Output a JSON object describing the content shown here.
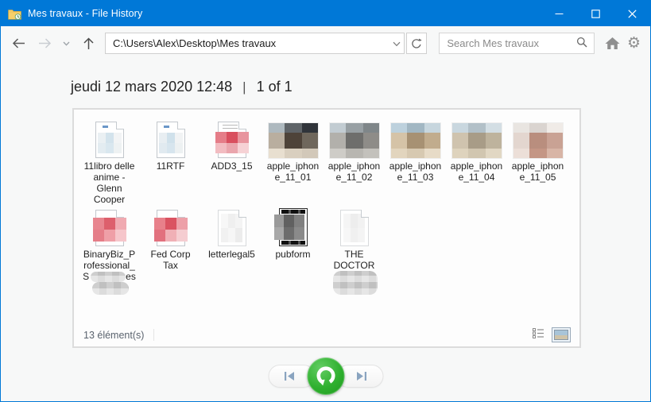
{
  "window": {
    "title": "Mes travaux - File History"
  },
  "toolbar": {
    "address": "C:\\Users\\Alex\\Desktop\\Mes travaux",
    "search_placeholder": "Search Mes travaux"
  },
  "icons": {
    "gear": "⚙"
  },
  "header": {
    "date": "jeudi 12 mars 2020 12:48",
    "separator": "|",
    "pager": "1 of 1"
  },
  "status": {
    "items_count": "13 élément(s)"
  },
  "colors": {
    "titlebar_bg": "#0078d7",
    "window_border": "#0078d7",
    "content_bg": "#f7f8f8",
    "panel_border": "#dcdcdc",
    "restore_green": "#2fb02f",
    "nav_icon_blue": "#8aa4c0",
    "icon_gray": "#8f8f8f"
  },
  "files": [
    {
      "label": "11libro delle anime - Glenn Cooper",
      "kind": "doc",
      "tint": "blue",
      "blocks": [
        "#eaf0f3",
        "#d3e3ec",
        "#f2f4f5",
        "#e3ecf1",
        "#d9e7ef",
        "#eef2f3"
      ]
    },
    {
      "label": "11RTF",
      "kind": "doc",
      "tint": "blue",
      "blocks": [
        "#e8eef2",
        "#d0e1eb",
        "#f1f3f4",
        "#e1eaf0",
        "#d7e5ee",
        "#edf1f2"
      ]
    },
    {
      "label": "ADD3_15",
      "kind": "doc",
      "tint": "red",
      "lines": true,
      "blocks": [
        "#e57d88",
        "#d94f5e",
        "#e8959e",
        "#f2bcc1",
        "#eaa6ad",
        "#f6d2d5"
      ]
    },
    {
      "label": "apple_iphone_11_01",
      "kind": "photo",
      "blocks": [
        "#aeb9bf",
        "#5f6468",
        "#30343a",
        "#b9ae9f",
        "#4e4339",
        "#6f675c",
        "#e8dfd0",
        "#d9cfbf",
        "#d2c8b9"
      ]
    },
    {
      "label": "apple_iphone_11_02",
      "kind": "photo",
      "blocks": [
        "#c2ccd2",
        "#98a0a4",
        "#7f8689",
        "#b2b0ab",
        "#6e6e6c",
        "#8e8c88",
        "#ceccc7",
        "#b8b6b1",
        "#c3c1bc"
      ]
    },
    {
      "label": "apple_iphone_11_03",
      "kind": "photo",
      "blocks": [
        "#bdd1dd",
        "#a2b7c3",
        "#c7d6de",
        "#d5c3a7",
        "#a79173",
        "#c1ac8d",
        "#e2d5be",
        "#d7c9b1",
        "#e7dbc7"
      ]
    },
    {
      "label": "apple_iphone_11_04",
      "kind": "photo",
      "blocks": [
        "#c9d7df",
        "#b2c0c8",
        "#d3dee4",
        "#cfc3ae",
        "#a89c87",
        "#beb39d",
        "#ded3bd",
        "#d1c6b0",
        "#e1d7c3"
      ]
    },
    {
      "label": "apple_iphone_11_05",
      "kind": "photo",
      "blocks": [
        "#e9e5e1",
        "#dad4d0",
        "#f0ebe7",
        "#e3d6cf",
        "#b98e7e",
        "#c9a294",
        "#ecdfd8",
        "#c49685",
        "#d8b5a6"
      ]
    },
    {
      "label_parts": [
        {
          "text": "BinaryBiz_Professional_S"
        },
        {
          "redact": [
            44,
            13
          ]
        },
        {
          "text": "es"
        },
        {
          "redact": [
            46,
            16
          ]
        }
      ],
      "kind": "doc",
      "tint": "red",
      "blocks": [
        "#e8858f",
        "#dd5f6c",
        "#f0aab1",
        "#e57d88",
        "#ef9fa7",
        "#f6c6cb"
      ]
    },
    {
      "label": "Fed Corp Tax",
      "kind": "doc",
      "tint": "red",
      "blocks": [
        "#e8808a",
        "#da5361",
        "#eda0a8",
        "#e2717e",
        "#f0b0b6",
        "#f5cdd1"
      ]
    },
    {
      "label": "letterlegal5",
      "kind": "doc",
      "tint": "white",
      "blocks": [
        "#f7f7f7",
        "#efefef",
        "#f4f4f4",
        "#f1f1f1",
        "#f6f6f6",
        "#ececec"
      ]
    },
    {
      "label": "pubform",
      "kind": "pub",
      "blocks": [
        "#9a9a9a",
        "#606060",
        "#808080",
        "#a8a8a8",
        "#6c6c6c",
        "#8a8a8a"
      ]
    },
    {
      "label_parts": [
        {
          "text": "THE DOCTOR"
        },
        {
          "redact": [
            56,
            30
          ]
        }
      ],
      "kind": "doc",
      "tint": "white",
      "blocks": [
        "#f5f5f5",
        "#ededed",
        "#f2f2f2",
        "#f7f7f7",
        "#f0f0f0",
        "#f4f4f4"
      ]
    }
  ]
}
